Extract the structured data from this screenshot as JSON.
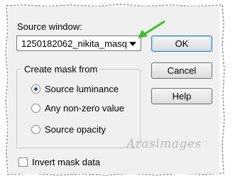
{
  "dialog": {
    "source_window_label": "Source window:",
    "source_window_value": "1250182062_nikita_masq",
    "buttons": {
      "ok": "OK",
      "cancel": "Cancel",
      "help": "Help"
    },
    "create_mask_group": {
      "title": "Create mask from",
      "options": [
        {
          "label": "Source luminance",
          "checked": true
        },
        {
          "label": "Any non-zero value",
          "checked": false
        },
        {
          "label": "Source opacity",
          "checked": false
        }
      ]
    },
    "invert_mask_label": "Invert mask data",
    "invert_mask_checked": false
  },
  "watermark": "Arasimages",
  "colors": {
    "arrow": "#3fbf2a",
    "dialog_bg": "#f0f0f0"
  }
}
